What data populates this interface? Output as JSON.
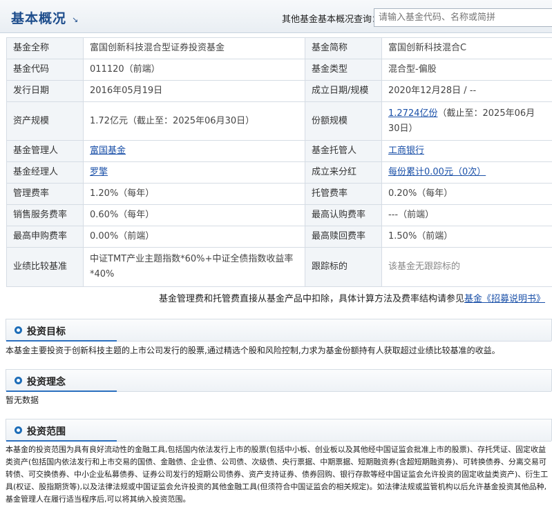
{
  "header": {
    "title": "基本概况",
    "arrow": "↘",
    "query_label": "其他基金基本概况查询：",
    "search_placeholder": "请输入基金代码、名称或简拼"
  },
  "info": {
    "full_name_label": "基金全称",
    "full_name": "富国创新科技混合型证券投资基金",
    "short_name_label": "基金简称",
    "short_name": "富国创新科技混合C",
    "code_label": "基金代码",
    "code": "011120（前端）",
    "type_label": "基金类型",
    "type": "混合型-偏股",
    "issue_date_label": "发行日期",
    "issue_date": "2016年05月19日",
    "est_label": "成立日期/规模",
    "est": "2020年12月28日 / --",
    "assets_label": "资产规模",
    "assets": "1.72亿元（截止至：2025年06月30日）",
    "shares_label": "份额规模",
    "shares_link": "1.2724亿份",
    "shares_rest": "（截止至：2025年06月30日）",
    "manager_co_label": "基金管理人",
    "manager_co": "富国基金",
    "custodian_label": "基金托管人",
    "custodian": "工商银行",
    "manager_label": "基金经理人",
    "manager": "罗擎",
    "dividend_label": "成立来分红",
    "dividend": "每份累计0.00元（0次）",
    "mgmt_fee_label": "管理费率",
    "mgmt_fee": "1.20%（每年）",
    "custody_fee_label": "托管费率",
    "custody_fee": "0.20%（每年）",
    "sales_fee_label": "销售服务费率",
    "sales_fee": "0.60%（每年）",
    "max_sub_label": "最高认购费率",
    "max_sub": "---（前端）",
    "max_purchase_label": "最高申购费率",
    "max_purchase": "0.00%（前端）",
    "max_redeem_label": "最高赎回费率",
    "max_redeem": "1.50%（前端）",
    "benchmark_label": "业绩比较基准",
    "benchmark": "中证TMT产业主题指数*60%+中证全债指数收益率*40%",
    "tracking_label": "跟踪标的",
    "tracking": "该基金无跟踪标的"
  },
  "note": {
    "text": "基金管理费和托管费直接从基金产品中扣除，具体计算方法及费率结构请参见",
    "link": "基金《招募说明书》"
  },
  "sections": {
    "goal_title": "投资目标",
    "goal_text": "本基金主要投资于创新科技主题的上市公司发行的股票,通过精选个股和风险控制,力求为基金份额持有人获取超过业绩比较基准的收益。",
    "idea_title": "投资理念",
    "idea_text": "暂无数据",
    "scope_title": "投资范围",
    "scope_text": "本基金的投资范围为具有良好流动性的金融工具,包括国内依法发行上市的股票(包括中小板、创业板以及其他经中国证监会批准上市的股票)、存托凭证、固定收益类资产(包括国内依法发行和上市交易的国债、金融债、企业债、公司债、次级债、央行票据、中期票据、短期融资券(含超短期融资券)、可转换债券、分离交易可转债、可交换债券、中小企业私募债券、证券公司发行的短期公司债券、资产支持证券、债券回购、银行存款等经中国证监会允许投资的固定收益类资产)、衍生工具(权证、股指期货等),以及法律法规或中国证监会允许投资的其他金融工具(但须符合中国证监会的相关规定)。如法律法规或监管机构以后允许基金投资其他品种,基金管理人在履行适当程序后,可以将其纳入投资范围。"
  }
}
